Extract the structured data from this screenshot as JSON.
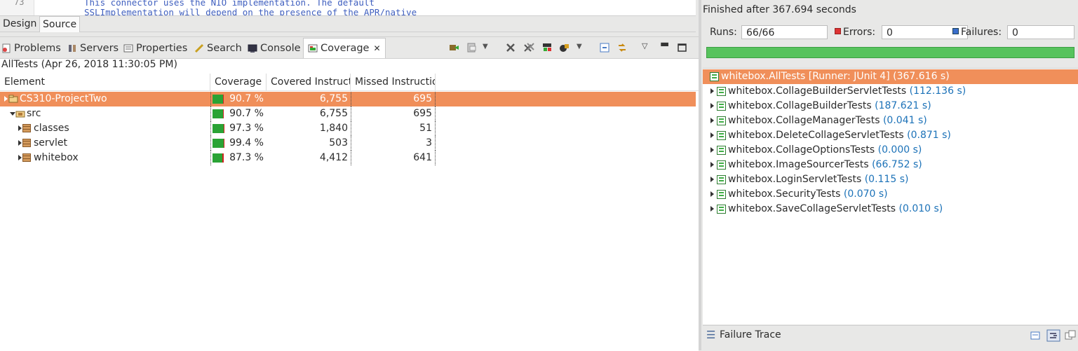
{
  "editor": {
    "line_number": "73",
    "code_lines": [
      "This connector uses the NIO implementation. The default",
      "SSLImplementation will depend on the presence of the APR/native"
    ]
  },
  "editor_tabs": [
    "Design",
    "Source"
  ],
  "view_tabs": {
    "problems": "Problems",
    "servers": "Servers",
    "properties": "Properties",
    "search": "Search",
    "console": "Console",
    "coverage": "Coverage"
  },
  "coverage": {
    "session": "AllTests (Apr 26, 2018 11:30:05 PM)",
    "columns": {
      "element": "Element",
      "coverage": "Coverage",
      "covered": "Covered Instructions",
      "missed": "Missed Instructions"
    },
    "rows": [
      {
        "name": "CS310-ProjectTwo",
        "coverage": "90.7 %",
        "covered": "6,755",
        "missed": "695",
        "ratio": 0.907
      },
      {
        "name": "src",
        "coverage": "90.7 %",
        "covered": "6,755",
        "missed": "695",
        "ratio": 0.907
      },
      {
        "name": "classes",
        "coverage": "97.3 %",
        "covered": "1,840",
        "missed": "51",
        "ratio": 0.973
      },
      {
        "name": "servlet",
        "coverage": "99.4 %",
        "covered": "503",
        "missed": "3",
        "ratio": 0.994
      },
      {
        "name": "whitebox",
        "coverage": "87.3 %",
        "covered": "4,412",
        "missed": "641",
        "ratio": 0.873
      }
    ]
  },
  "junit": {
    "finished": "Finished after 367.694 seconds",
    "runs_label": "Runs:",
    "runs": "66/66",
    "errors_label": "Errors:",
    "errors": "0",
    "failures_label": "Failures:",
    "failures": "0",
    "progress": 1.0,
    "root": {
      "name": "whitebox.AllTests [Runner: JUnit 4]",
      "time": "(367.616 s)"
    },
    "tests": [
      {
        "name": "whitebox.CollageBuilderServletTests",
        "time": "(112.136 s)"
      },
      {
        "name": "whitebox.CollageBuilderTests",
        "time": "(187.621 s)"
      },
      {
        "name": "whitebox.CollageManagerTests",
        "time": "(0.041 s)"
      },
      {
        "name": "whitebox.DeleteCollageServletTests",
        "time": "(0.871 s)"
      },
      {
        "name": "whitebox.CollageOptionsTests",
        "time": "(0.000 s)"
      },
      {
        "name": "whitebox.ImageSourcerTests",
        "time": "(66.752 s)"
      },
      {
        "name": "whitebox.LoginServletTests",
        "time": "(0.115 s)"
      },
      {
        "name": "whitebox.SecurityTests",
        "time": "(0.070 s)"
      },
      {
        "name": "whitebox.SaveCollageServletTests",
        "time": "(0.010 s)"
      }
    ],
    "failure_trace": "Failure Trace"
  },
  "colors": {
    "selection": "#f08f5a",
    "success": "#57c35d",
    "covered": "#2aa335",
    "missed": "#d42020",
    "time": "#1c72b8"
  }
}
